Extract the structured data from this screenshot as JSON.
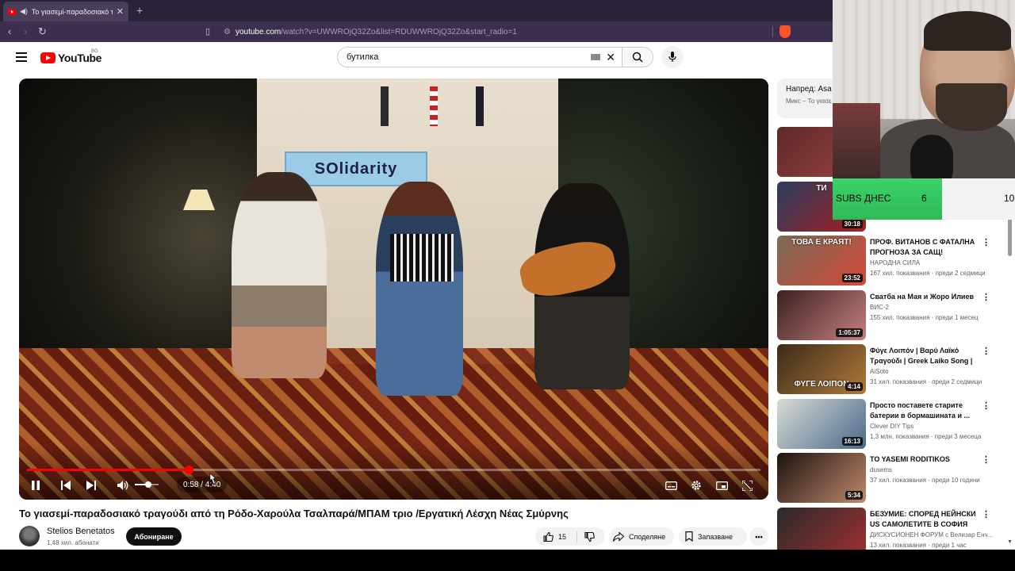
{
  "browser": {
    "tab_title": "Το γιασεμί-παραδοσιακό τρα",
    "new_tab": "+",
    "url_host": "youtube.com",
    "url_path": "/watch?v=UWWROjQ32Zo&list=RDUWWROjQ32Zo&start_radio=1"
  },
  "header": {
    "logo_word": "YouTube",
    "region": "BG",
    "search_value": "бутилка"
  },
  "player": {
    "progress_fraction": 0.22,
    "volume_fraction": 0.55,
    "time_display": "0:58 / 4:40",
    "scene_sign": "SOlidarity"
  },
  "video": {
    "title": "Το γιασεμί-παραδοσιακό τραγούδι από τη Ρόδο-Χαρούλα Τσαλπαρά/ΜΠΑΜ τριο /Εργατική Λέσχη Νέας Σμύρνης",
    "channel": "Stelios Benetatos",
    "subscribers": "1,48 хил. абонати",
    "subscribe_label": "Абониране",
    "likes": "15",
    "share_label": "Споделяне",
    "save_label": "Запазване"
  },
  "sidebar": {
    "playlist_next": "Напред: Asa та",
    "playlist_sub": "Микс – То γιασε",
    "recommendations": [
      {
        "title": "",
        "channel": "",
        "meta": "",
        "duration": "",
        "thumb_text": "",
        "colors": [
          "#5a2a2a",
          "#a04040"
        ]
      },
      {
        "title": "",
        "channel": "",
        "meta": "",
        "duration": "30:18",
        "thumb_text": "ТИ",
        "colors": [
          "#2b3d5e",
          "#a52020"
        ]
      },
      {
        "title": "ПРОФ. ВИТАНОВ С ФАТАЛНА ПРОГНОЗА ЗА САЩ!",
        "channel": "НАРОДНА СИЛА",
        "meta": "167 хил. показвания · преди 2 седмици",
        "duration": "23:52",
        "thumb_text": "ТОВА Е КРАЯТ!",
        "colors": [
          "#7a6a55",
          "#d34a3a"
        ]
      },
      {
        "title": "Сватба на Мая и Жоро Илиев",
        "channel": "ВИС-2",
        "meta": "155 хил. показвания · преди 1 месец",
        "duration": "1:05:37",
        "thumb_text": "",
        "colors": [
          "#3a2020",
          "#c78080"
        ]
      },
      {
        "title": "Φύγε Λοιπόν | Βαρύ Λαϊκό Τραγούδι | Greek Laiko Song | ...",
        "channel": "AiSoto",
        "meta": "31 хил. показвания · преди 2 седмици",
        "duration": "4:14",
        "thumb_text": "ΦΥΓΕ ΛΟΙΠΟΝ",
        "colors": [
          "#3b2b1a",
          "#b07a3a"
        ]
      },
      {
        "title": "Просто поставете старите батерии в бормашината и ...",
        "channel": "Clever DIY Tips",
        "meta": "1,3 млн. показвания · преди 3 месеца",
        "duration": "16:13",
        "thumb_text": "",
        "colors": [
          "#d8dcd4",
          "#4a6a8a"
        ]
      },
      {
        "title": "TO YASEMI RODITIKOS",
        "channel": "dusems",
        "meta": "37 хил. показвания · преди 10 години",
        "duration": "5:34",
        "thumb_text": "",
        "colors": [
          "#1a1210",
          "#c08a6a"
        ]
      },
      {
        "title": "БЕЗУМИЕ: СПОРЕД НЕЙНСКИ US САМОЛЕТИТЕ В СОФИЯ Н...",
        "channel": "ДИСКУСИОНЕН ФОРУМ с Велизар Енч...",
        "meta": "13 хил. показвания · преди 1 час",
        "duration": "",
        "thumb_text": "",
        "colors": [
          "#2a2a2a",
          "#a03030"
        ]
      }
    ]
  },
  "overlay": {
    "subs_label": "SUBS ДНЕС",
    "subs_count": "6",
    "subs_goal": "10",
    "subs_fraction": 0.6
  }
}
